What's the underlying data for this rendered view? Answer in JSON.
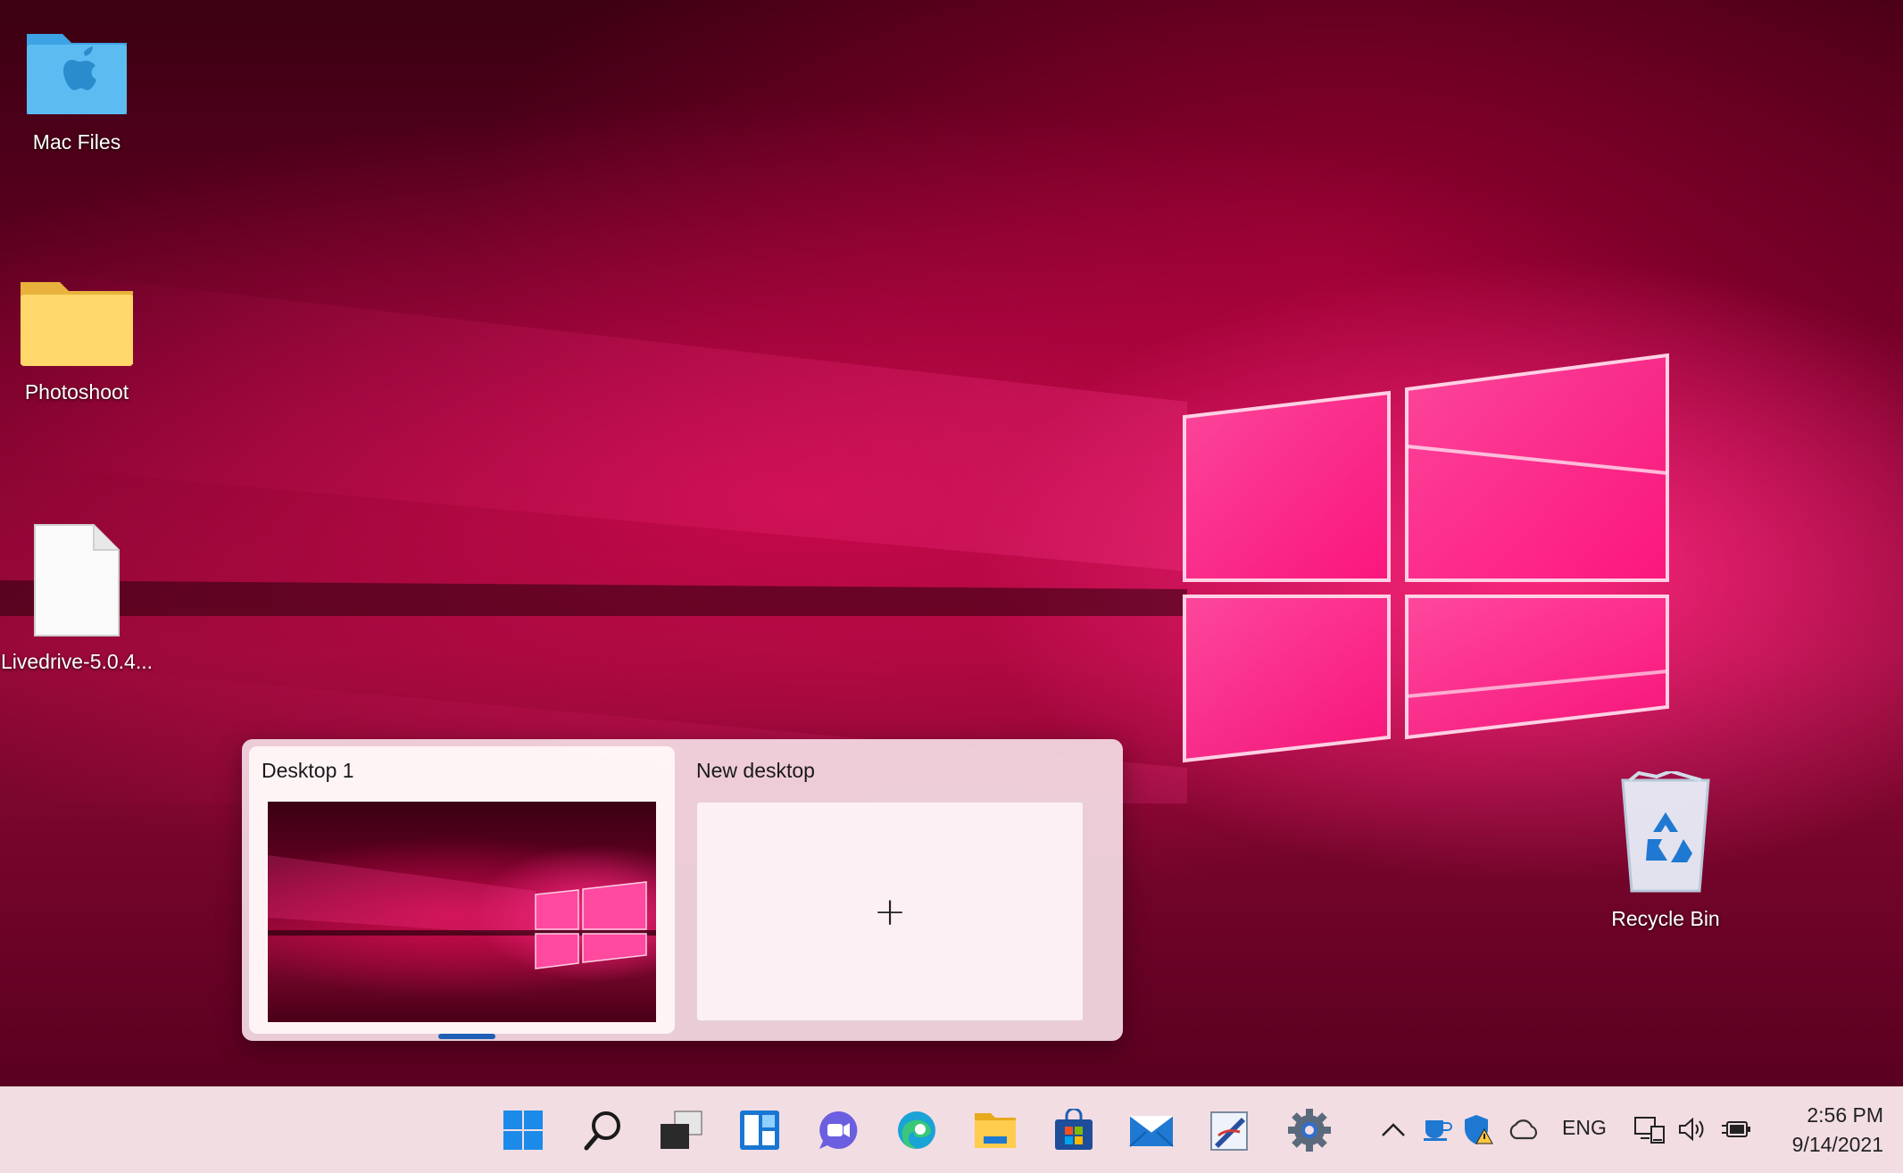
{
  "desktop": {
    "icons": [
      {
        "label": "Mac Files",
        "icon": "mac-folder-icon"
      },
      {
        "label": "Photoshoot",
        "icon": "folder-icon"
      },
      {
        "label": "Livedrive-5.0.4...",
        "icon": "file-icon"
      },
      {
        "label": "Recycle Bin",
        "icon": "recycle-bin-icon"
      }
    ]
  },
  "task_view": {
    "desktops": [
      {
        "title": "Desktop 1",
        "active": true
      },
      {
        "title": "New desktop",
        "action_glyph": "+"
      }
    ]
  },
  "taskbar": {
    "apps": [
      "start-icon",
      "search-icon",
      "task-view-icon",
      "widgets-icon",
      "chat-icon",
      "edge-icon",
      "file-explorer-icon",
      "store-icon",
      "mail-icon",
      "paint-icon",
      "settings-icon"
    ],
    "tray": {
      "language": "ENG",
      "time": "2:56 PM",
      "date": "9/14/2021"
    }
  },
  "colors": {
    "accent": "#1f5fb5",
    "taskbar_bg": "#f2dde3"
  }
}
